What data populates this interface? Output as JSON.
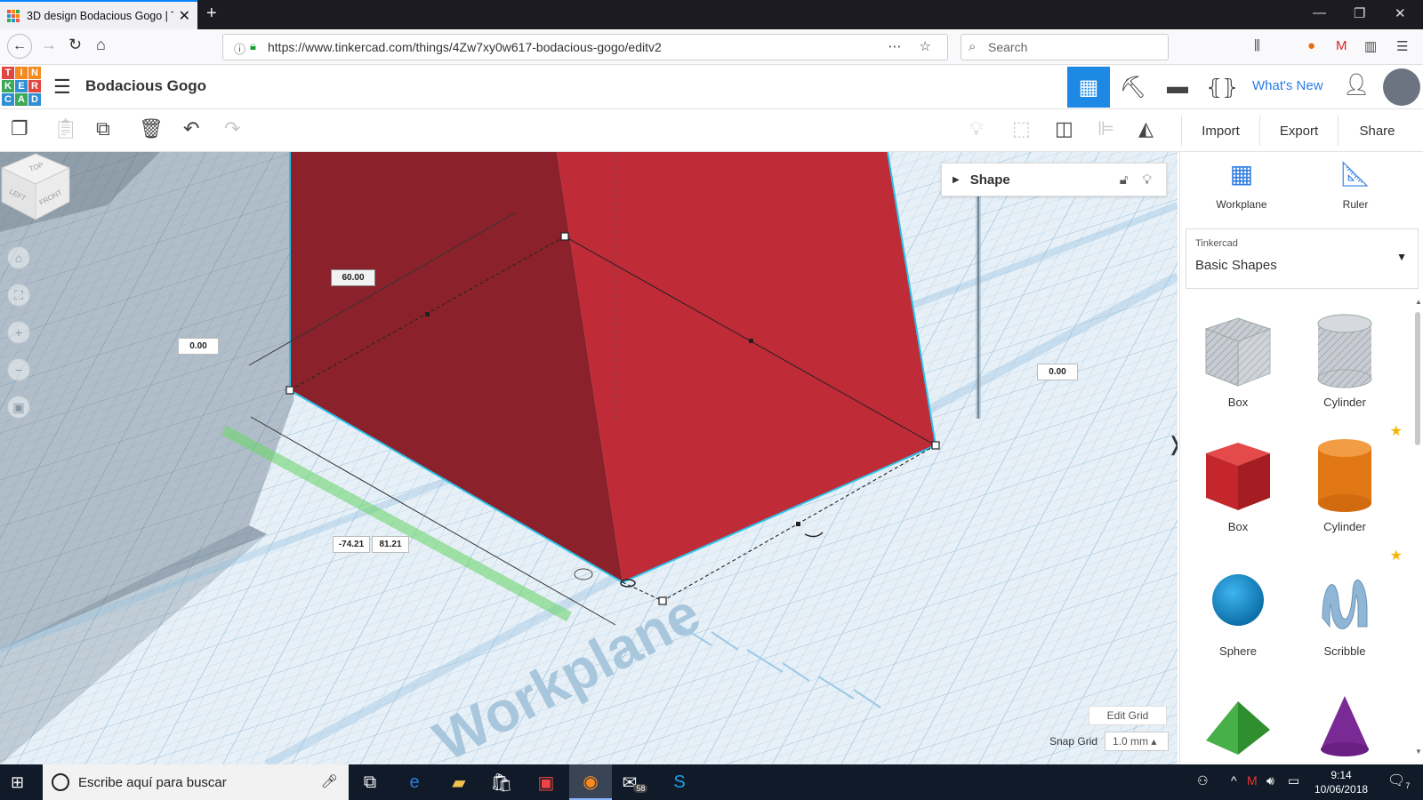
{
  "browser": {
    "tab_title": "3D design Bodacious Gogo | Ti",
    "url": "https://www.tinkercad.com/things/4Zw7xy0w617-bodacious-gogo/editv2",
    "search_placeholder": "Search"
  },
  "app": {
    "logo_letters": [
      "T",
      "I",
      "N",
      "K",
      "E",
      "R",
      "C",
      "A",
      "D"
    ],
    "project_title": "Bodacious Gogo",
    "whats_new": "What's New"
  },
  "toolbar": {
    "import_label": "Import",
    "export_label": "Export",
    "share_label": "Share"
  },
  "workspace": {
    "dim_height": "60.00",
    "dim_left_offset": "0.00",
    "dim_right_offset": "0.00",
    "dim_pos": "-74.21",
    "dim_len": "81.21",
    "workplane_watermark": "Workplane",
    "viewcube": {
      "top": "TOP",
      "left": "LEFT",
      "front": "FRONT"
    },
    "shape_panel_label": "Shape",
    "edit_grid_label": "Edit Grid",
    "snap_grid_label": "Snap Grid",
    "snap_grid_value": "1.0 mm ▴"
  },
  "right_panel": {
    "workplane_label": "Workplane",
    "ruler_label": "Ruler",
    "library_provider": "Tinkercad",
    "library_name": "Basic Shapes",
    "shapes": [
      {
        "label": "Box",
        "kind": "box-hole",
        "starred": false
      },
      {
        "label": "Cylinder",
        "kind": "cyl-hole",
        "starred": false
      },
      {
        "label": "Box",
        "kind": "box-red",
        "starred": false
      },
      {
        "label": "Cylinder",
        "kind": "cyl-orange",
        "starred": true
      },
      {
        "label": "Sphere",
        "kind": "sphere",
        "starred": false
      },
      {
        "label": "Scribble",
        "kind": "scribble",
        "starred": true
      },
      {
        "label": "",
        "kind": "roof",
        "starred": false
      },
      {
        "label": "",
        "kind": "cone",
        "starred": false
      }
    ]
  },
  "taskbar": {
    "search_placeholder": "Escribe aquí para buscar",
    "mail_badge": "58",
    "time": "9:14",
    "date": "10/06/2018",
    "notif_count": "7"
  },
  "colors": {
    "accent": "#1e88e5",
    "shape_dark": "#8b222b",
    "shape_light": "#bf2b37",
    "workplane": "#dce9f2"
  }
}
